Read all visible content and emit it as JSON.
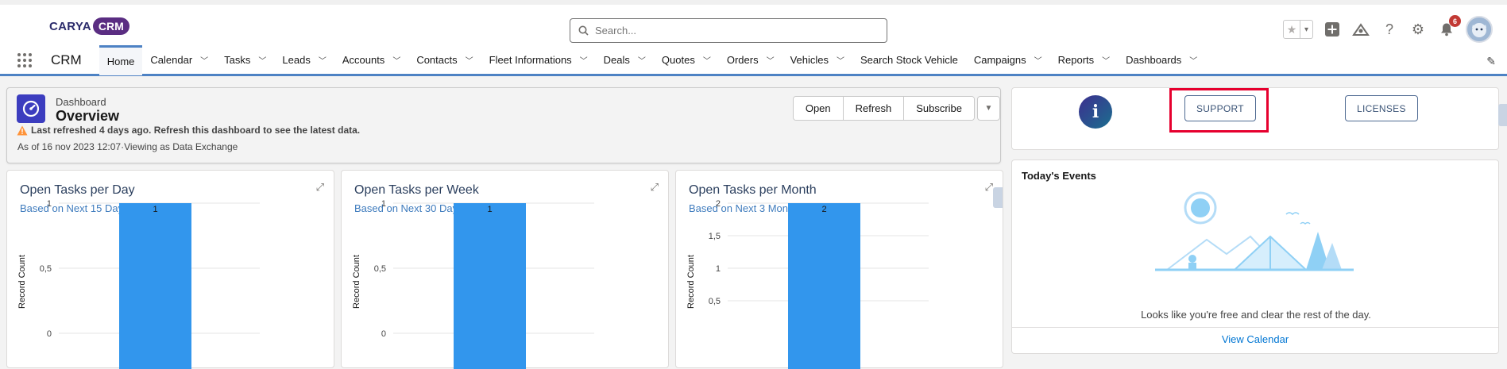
{
  "header": {
    "logo_text": "CARYA",
    "logo_pill": "CRM",
    "search_placeholder": "Search...",
    "notification_count": "6"
  },
  "nav": {
    "app_name": "CRM",
    "items": [
      {
        "label": "Home",
        "active": true,
        "menu": false
      },
      {
        "label": "Calendar",
        "menu": true
      },
      {
        "label": "Tasks",
        "menu": true
      },
      {
        "label": "Leads",
        "menu": true
      },
      {
        "label": "Accounts",
        "menu": true
      },
      {
        "label": "Contacts",
        "menu": true
      },
      {
        "label": "Fleet Informations",
        "menu": true
      },
      {
        "label": "Deals",
        "menu": true
      },
      {
        "label": "Quotes",
        "menu": true
      },
      {
        "label": "Orders",
        "menu": true
      },
      {
        "label": "Vehicles",
        "menu": true
      },
      {
        "label": "Search Stock Vehicle",
        "menu": false
      },
      {
        "label": "Campaigns",
        "menu": true
      },
      {
        "label": "Reports",
        "menu": true
      },
      {
        "label": "Dashboards",
        "menu": true
      }
    ]
  },
  "dashboard": {
    "type_label": "Dashboard",
    "title": "Overview",
    "warning": "Last refreshed 4 days ago. Refresh this dashboard to see the latest data.",
    "as_of": "As of 16 nov 2023 12:07·Viewing as Data Exchange",
    "buttons": {
      "open": "Open",
      "refresh": "Refresh",
      "subscribe": "Subscribe"
    }
  },
  "charts": [
    {
      "title": "Open Tasks per Day",
      "subtitle": "Based on Next 15 Days"
    },
    {
      "title": "Open Tasks per Week",
      "subtitle": "Based on Next 30 Days"
    },
    {
      "title": "Open Tasks per Month",
      "subtitle": "Based on Next 3 Months"
    }
  ],
  "chart_data": [
    {
      "type": "bar",
      "ylabel": "Record Count",
      "yticks": [
        "1",
        "0,5",
        "0"
      ],
      "ylim": [
        0,
        1
      ],
      "values": [
        1
      ],
      "data_labels": [
        "1"
      ],
      "color": "#3296ed"
    },
    {
      "type": "bar",
      "ylabel": "Record Count",
      "yticks": [
        "1",
        "0,5",
        "0"
      ],
      "ylim": [
        0,
        1
      ],
      "values": [
        1
      ],
      "data_labels": [
        "1"
      ],
      "color": "#3296ed"
    },
    {
      "type": "bar",
      "ylabel": "Record Count",
      "yticks": [
        "2",
        "1,5",
        "1",
        "0,5"
      ],
      "ylim": [
        0,
        2
      ],
      "values": [
        2
      ],
      "data_labels": [
        "2"
      ],
      "color": "#3296ed"
    }
  ],
  "side": {
    "support_label": "SUPPORT",
    "licenses_label": "LICENSES",
    "events_title": "Today's Events",
    "events_message": "Looks like you're free and clear the rest of the day.",
    "view_calendar": "View Calendar"
  },
  "colors": {
    "accent": "#4d82c4",
    "bar": "#3296ed",
    "brand_pill": "#5a2d82",
    "highlight": "#e6002e"
  }
}
